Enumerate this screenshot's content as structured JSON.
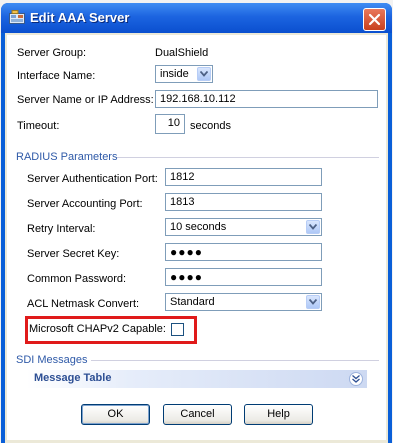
{
  "window": {
    "title": "Edit AAA Server"
  },
  "form": {
    "server_group_label": "Server Group:",
    "server_group_value": "DualShield",
    "interface_label": "Interface Name:",
    "interface_value": "inside",
    "server_name_label": "Server Name or IP Address:",
    "server_name_value": "192.168.10.112",
    "timeout_label": "Timeout:",
    "timeout_value": "10",
    "timeout_unit": "seconds"
  },
  "radius": {
    "section_title": "RADIUS Parameters",
    "auth_port_label": "Server Authentication Port:",
    "auth_port_value": "1812",
    "acct_port_label": "Server Accounting Port:",
    "acct_port_value": "1813",
    "retry_label": "Retry Interval:",
    "retry_value": "10 seconds",
    "secret_label": "Server Secret Key:",
    "secret_value": "●●●●",
    "common_pw_label": "Common Password:",
    "common_pw_value": "●●●●",
    "acl_label": "ACL Netmask Convert:",
    "acl_value": "Standard",
    "chap_label": "Microsoft CHAPv2 Capable:",
    "chap_checked": false
  },
  "sdi": {
    "section_title": "SDI Messages",
    "message_table_label": "Message Table"
  },
  "buttons": {
    "ok": "OK",
    "cancel": "Cancel",
    "help": "Help"
  },
  "colors": {
    "titlebar": "#0a5fd8",
    "section_title": "#2f5aa8",
    "highlight": "#e01a1a",
    "close_button": "#d5532e"
  }
}
